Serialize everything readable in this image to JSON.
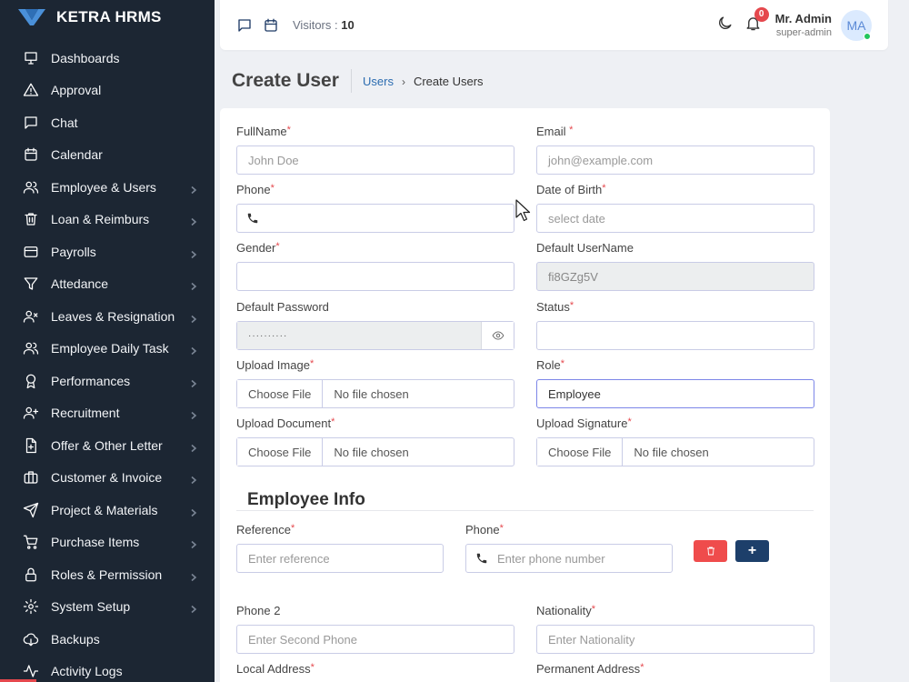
{
  "brand": {
    "name": "KETRA HRMS",
    "color": "#1c2633",
    "accent": "#2b6cb0"
  },
  "sidebar": {
    "items": [
      {
        "label": "Dashboards",
        "icon": "monitor-icon",
        "chevron": false
      },
      {
        "label": "Approval",
        "icon": "warning-icon",
        "chevron": false
      },
      {
        "label": "Chat",
        "icon": "chat-icon",
        "chevron": false
      },
      {
        "label": "Calendar",
        "icon": "calendar-icon",
        "chevron": false
      },
      {
        "label": "Employee & Users",
        "icon": "users-icon",
        "chevron": true
      },
      {
        "label": "Loan & Reimburs",
        "icon": "trash-icon",
        "chevron": true
      },
      {
        "label": "Payrolls",
        "icon": "card-icon",
        "chevron": true
      },
      {
        "label": "Attedance",
        "icon": "filter-icon",
        "chevron": true
      },
      {
        "label": "Leaves & Resignation",
        "icon": "user-x-icon",
        "chevron": true
      },
      {
        "label": "Employee Daily Task",
        "icon": "users-icon",
        "chevron": true
      },
      {
        "label": "Performances",
        "icon": "award-icon",
        "chevron": true
      },
      {
        "label": "Recruitment",
        "icon": "user-plus-icon",
        "chevron": true
      },
      {
        "label": "Offer & Other Letter",
        "icon": "file-plus-icon",
        "chevron": true
      },
      {
        "label": "Customer & Invoice",
        "icon": "briefcase-icon",
        "chevron": true
      },
      {
        "label": "Project & Materials",
        "icon": "send-icon",
        "chevron": true
      },
      {
        "label": "Purchase Items",
        "icon": "cart-icon",
        "chevron": true
      },
      {
        "label": "Roles & Permission",
        "icon": "lock-icon",
        "chevron": true
      },
      {
        "label": "System Setup",
        "icon": "gear-icon",
        "chevron": true
      },
      {
        "label": "Backups",
        "icon": "cloud-download-icon",
        "chevron": false
      },
      {
        "label": "Activity Logs",
        "icon": "activity-icon",
        "chevron": false
      }
    ]
  },
  "topbar": {
    "visitors_label": "Visitors :",
    "visitors_count": "10",
    "notifications": "0",
    "user_name": "Mr. Admin",
    "user_role": "super-admin",
    "avatar_initials": "MA"
  },
  "page": {
    "title": "Create User",
    "breadcrumb_link": "Users",
    "breadcrumb_current": "Create Users"
  },
  "form": {
    "fullname": {
      "label": "FullName",
      "placeholder": "John Doe"
    },
    "email": {
      "label": "Email",
      "placeholder": "john@example.com"
    },
    "phone": {
      "label": "Phone",
      "value": ""
    },
    "dob": {
      "label": "Date of Birth",
      "placeholder": "select date"
    },
    "gender": {
      "label": "Gender",
      "value": ""
    },
    "default_username": {
      "label": "Default UserName",
      "value": "fi8GZg5V"
    },
    "default_password": {
      "label": "Default Password",
      "value": "··········"
    },
    "status": {
      "label": "Status",
      "value": ""
    },
    "upload_image": {
      "label": "Upload Image",
      "button": "Choose File",
      "file": "No file chosen"
    },
    "role": {
      "label": "Role",
      "value": "Employee"
    },
    "upload_document": {
      "label": "Upload Document",
      "button": "Choose File",
      "file": "No file chosen"
    },
    "upload_signature": {
      "label": "Upload Signature",
      "button": "Choose File",
      "file": "No file chosen"
    }
  },
  "employee_info": {
    "title": "Employee Info",
    "reference": {
      "label": "Reference",
      "placeholder": "Enter reference"
    },
    "phone": {
      "label": "Phone",
      "placeholder": "Enter phone number"
    },
    "add_button": "+",
    "phone2": {
      "label": "Phone 2",
      "placeholder": "Enter Second Phone"
    },
    "nationality": {
      "label": "Nationality",
      "placeholder": "Enter Nationality"
    },
    "local_address": {
      "label": "Local Address"
    },
    "permanent_address": {
      "label": "Permanent Address"
    }
  },
  "required_mark": "*"
}
